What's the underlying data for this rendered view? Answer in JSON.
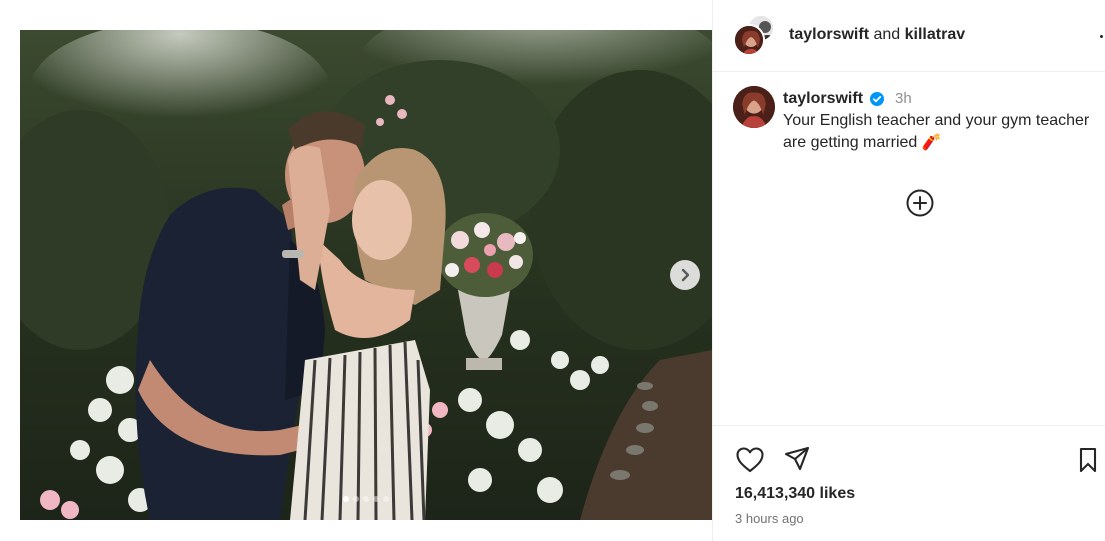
{
  "post": {
    "image_alt": "Couple embracing in a garden with a flower urn",
    "carousel": {
      "total_slides": 5,
      "active_slide": 1
    },
    "next_button_icon": "chevron-right-icon"
  },
  "header": {
    "author": "taylorswift",
    "joiner": "and",
    "collaborator": "killatrav",
    "more_icon": "more-horizontal-icon"
  },
  "caption": {
    "username": "taylorswift",
    "verified_icon": "verified-badge-icon",
    "time": "3h",
    "text": "Your English teacher and your gym teacher are getting married 🧨"
  },
  "add_comment_icon": "plus-circle-icon",
  "actions": {
    "like_icon": "heart-icon",
    "share_icon": "send-icon",
    "save_icon": "bookmark-icon"
  },
  "likes": "16,413,340 likes",
  "posted_ago": "3 hours ago",
  "colors": {
    "text": "#262626",
    "muted": "#737373",
    "verified": "#0095f6",
    "divider": "#efefef"
  }
}
